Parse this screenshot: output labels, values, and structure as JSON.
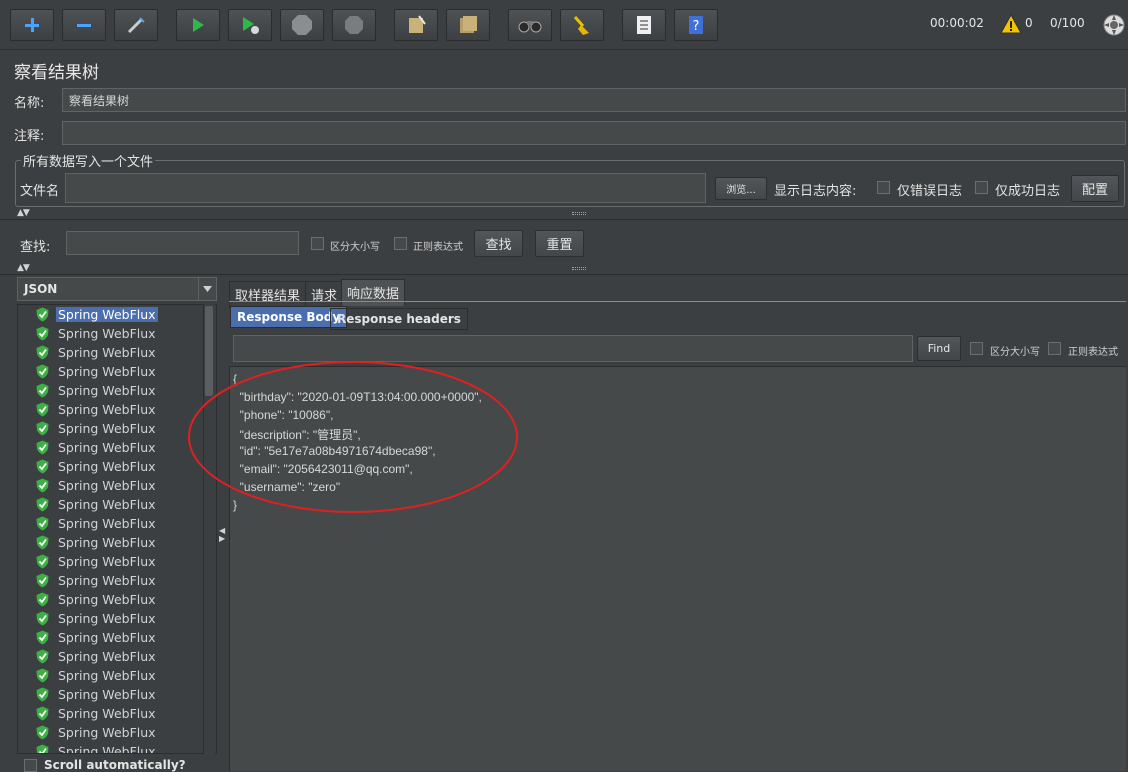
{
  "toolbar": {
    "timer": "00:00:02",
    "warnings": "0",
    "threads": "0/100",
    "icons": [
      "add-icon",
      "remove-icon",
      "wand-icon",
      "start-icon",
      "start-no-pause-icon",
      "stop-icon",
      "shutdown-icon",
      "clear-icon",
      "clear-all-icon",
      "search-icon",
      "broom-icon",
      "function-helper-icon",
      "help-icon"
    ]
  },
  "panel": {
    "title": "察看结果树",
    "name_label": "名称:",
    "name_value": "察看结果树",
    "comment_label": "注释:",
    "comment_value": ""
  },
  "file_group": {
    "title": "所有数据写入一个文件",
    "file_label": "文件名",
    "file_value": "",
    "browse_label": "浏览...",
    "log_label": "显示日志内容:",
    "errors_only": "仅错误日志",
    "success_only": "仅成功日志",
    "config_label": "配置"
  },
  "search_bar": {
    "label": "查找:",
    "value": "",
    "case_label": "区分大小写",
    "regex_label": "正则表达式",
    "find_label": "查找",
    "reset_label": "重置"
  },
  "renderer": {
    "selected": "JSON"
  },
  "tree": {
    "items": [
      "Spring WebFlux",
      "Spring WebFlux",
      "Spring WebFlux",
      "Spring WebFlux",
      "Spring WebFlux",
      "Spring WebFlux",
      "Spring WebFlux",
      "Spring WebFlux",
      "Spring WebFlux",
      "Spring WebFlux",
      "Spring WebFlux",
      "Spring WebFlux",
      "Spring WebFlux",
      "Spring WebFlux",
      "Spring WebFlux",
      "Spring WebFlux",
      "Spring WebFlux",
      "Spring WebFlux",
      "Spring WebFlux",
      "Spring WebFlux",
      "Spring WebFlux",
      "Spring WebFlux",
      "Spring WebFlux",
      "Spring WebFlux"
    ],
    "scroll_label": "Scroll automatically?"
  },
  "tabs": [
    "取样器结果",
    "请求",
    "响应数据"
  ],
  "subtabs": [
    "Response Body",
    "Response headers"
  ],
  "response_search": {
    "value": "",
    "find_label": "Find",
    "case_label": "区分大小写",
    "regex_label": "正则表达式"
  },
  "response_body": [
    "{",
    "  \"birthday\": \"2020-01-09T13:04:00.000+0000\",",
    "  \"phone\": \"10086\",",
    "  \"description\": \"管理员\",",
    "  \"id\": \"5e17e7a08b4971674dbeca98\",",
    "  \"email\": \"2056423011@qq.com\",",
    "  \"username\": \"zero\"",
    "}"
  ],
  "colors": {
    "background": "#3c3f41",
    "selection": "#4b6eaf",
    "annotation": "#e02020",
    "success": "#3cb043"
  }
}
